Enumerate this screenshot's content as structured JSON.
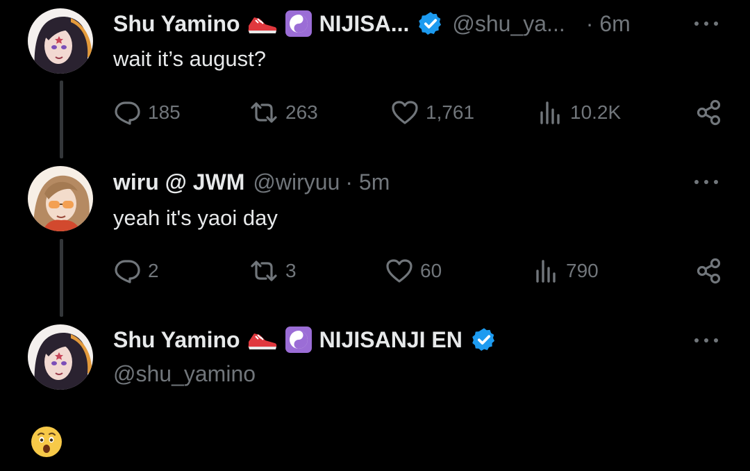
{
  "tweets": [
    {
      "author_name": "Shu Yamino",
      "org_label": "NIJISA...",
      "handle": "@shu_ya...",
      "time": "· 6m",
      "text": "wait it’s august?",
      "replies": "185",
      "reposts": "263",
      "likes": "1,761",
      "views": "10.2K"
    },
    {
      "author_name": "wiru @ JWM",
      "handle": "@wiryuu",
      "time": "· 5m",
      "text": "yeah it's yaoi day",
      "replies": "2",
      "reposts": "3",
      "likes": "60",
      "views": "790"
    },
    {
      "author_name": "Shu Yamino",
      "org_label": "NIJISANJI EN",
      "handle": "@shu_yamino",
      "text": "😯"
    }
  ],
  "colors": {
    "background": "#000000",
    "text_primary": "#e7e9ea",
    "text_secondary": "#71767b",
    "verified_blue": "#1d9bf0",
    "thread_line": "#333639",
    "purple_badge": "#9b6dd6"
  },
  "icons": {
    "reply": "reply-icon",
    "repost": "repost-icon",
    "like": "heart-icon",
    "views": "views-icon",
    "share": "share-icon",
    "verified": "verified-badge-icon",
    "sneaker": "sneaker-emoji-icon",
    "yin_yang": "yin-yang-emoji-icon",
    "more": "more-options-icon"
  }
}
